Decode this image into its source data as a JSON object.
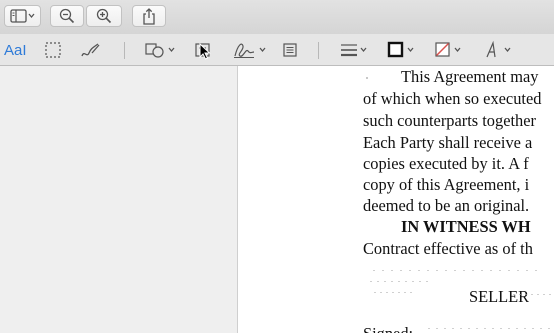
{
  "toolbar": {
    "buttons": [
      {
        "id": "sidebar",
        "icon": "sidebar-icon"
      },
      {
        "id": "zoom-out",
        "icon": "zoom-out-icon"
      },
      {
        "id": "zoom-in",
        "icon": "zoom-in-icon"
      },
      {
        "id": "share",
        "icon": "share-icon"
      }
    ]
  },
  "markup": {
    "text_style_label": "AaI",
    "tools": [
      "text-style-icon",
      "rect-selection-icon",
      "sketch-icon",
      "shapes-icon",
      "text-box-icon",
      "sign-icon",
      "note-icon",
      "shape-style-icon",
      "border-color-icon",
      "fill-color-icon",
      "font-icon"
    ],
    "accent_color": "#2f7bd8",
    "fill_slash_color": "#d9534f"
  },
  "document": {
    "lines": [
      "This Agreement may",
      "of which when so executed",
      "such counterparts together",
      "Each Party shall receive a",
      "copies executed by it. A f",
      "copy of this Agreement, i",
      "deemed to be an original.",
      "IN WITNESS WH",
      "Contract effective as of th",
      "SELLER",
      "Signed:"
    ]
  }
}
